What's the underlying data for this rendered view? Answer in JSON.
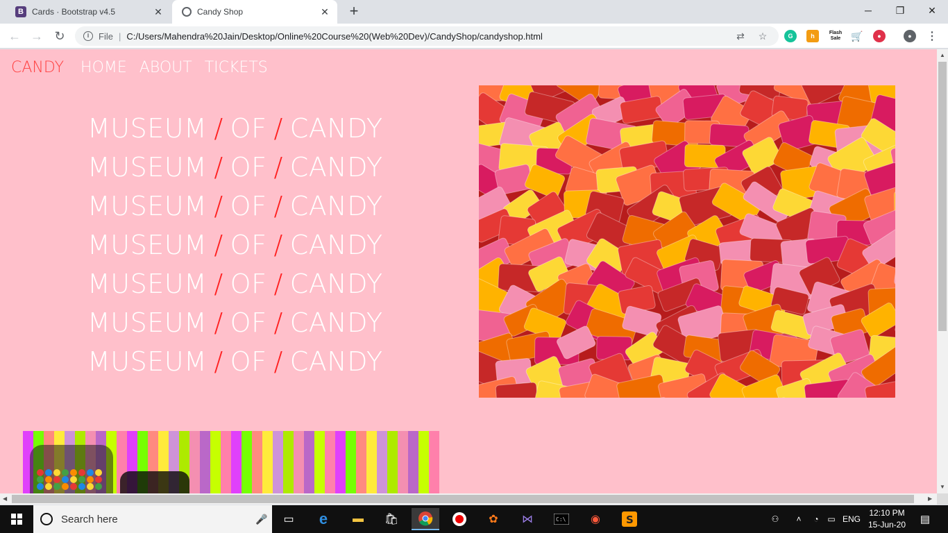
{
  "browser": {
    "tabs": [
      {
        "title": "Cards · Bootstrap v4.5",
        "favicon": "bootstrap-icon",
        "active": false
      },
      {
        "title": "Candy Shop",
        "favicon": "globe-icon",
        "active": true
      }
    ],
    "new_tab_label": "+",
    "address": {
      "scheme_label": "File",
      "url": "C:/Users/Mahendra%20Jain/Desktop/Online%20Course%20(Web%20Dev)/CandyShop/candyshop.html"
    },
    "extensions": [
      "grammarly-icon",
      "honey-icon",
      "flash-sale-icon",
      "cart-icon",
      "record-icon"
    ],
    "flash_sale_label": "Flash Sale"
  },
  "page": {
    "nav": {
      "brand": "CANDY",
      "links": [
        "HOME",
        "ABOUT",
        "TICKETS"
      ]
    },
    "headline": {
      "word1": "MUSEUM",
      "word2": "OF",
      "word3": "CANDY",
      "separator": "/",
      "repeat": 7
    },
    "colors": {
      "background": "#ffc0cb",
      "brand": "#ff4040",
      "text": "#ffffff",
      "separator": "#ff2020"
    }
  },
  "taskbar": {
    "search_placeholder": "Search here",
    "language": "ENG",
    "time": "12:10 PM",
    "date": "15-Jun-20"
  }
}
